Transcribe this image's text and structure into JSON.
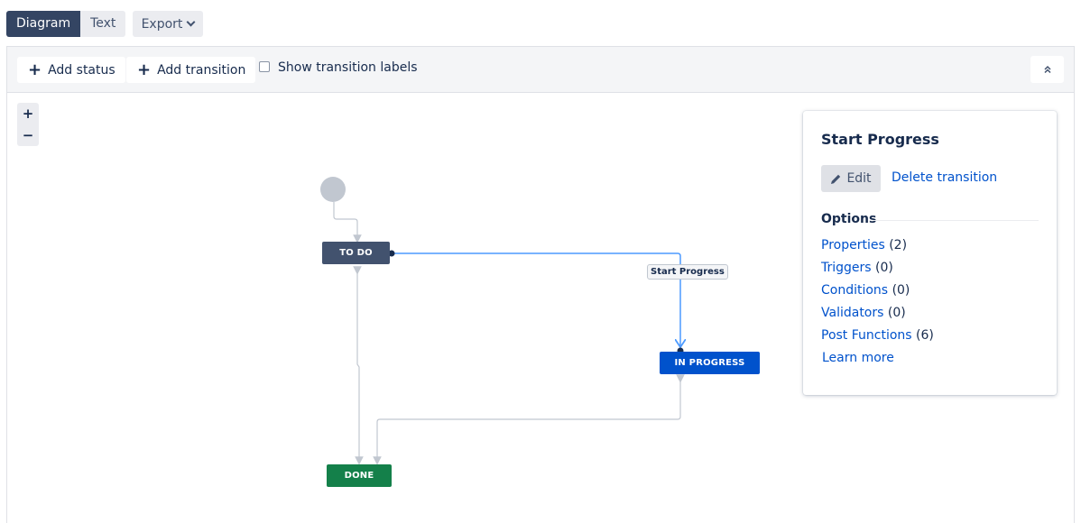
{
  "view_tabs": {
    "diagram": "Diagram",
    "text": "Text"
  },
  "export": {
    "label": "Export"
  },
  "toolbar": {
    "add_status": "Add status",
    "add_transition": "Add transition",
    "show_labels": "Show transition labels",
    "show_labels_checked": false
  },
  "zoom": {
    "in": "+",
    "out": "−"
  },
  "statuses": {
    "todo": {
      "label": "TO DO",
      "color": "#42526e"
    },
    "in_progress": {
      "label": "IN PROGRESS",
      "color": "#0052cc"
    },
    "done": {
      "label": "DONE",
      "color": "#14804a"
    }
  },
  "transition_label": "Start Progress",
  "panel": {
    "title": "Start Progress",
    "edit": "Edit",
    "delete": "Delete transition",
    "options_heading": "Options",
    "options": [
      {
        "link": "Properties",
        "count": "(2)"
      },
      {
        "link": "Triggers",
        "count": "(0)"
      },
      {
        "link": "Conditions",
        "count": "(0)"
      },
      {
        "link": "Validators",
        "count": "(0)"
      },
      {
        "link": "Post Functions",
        "count": "(6)"
      }
    ],
    "learn_more": "Learn more"
  },
  "colors": {
    "selected_transition": "#4c9aff",
    "transition": "#c1c7d0",
    "link": "#0052cc"
  },
  "icons": [
    "plus-icon",
    "chevron-down-icon",
    "double-chevron-up-icon",
    "pencil-icon"
  ]
}
